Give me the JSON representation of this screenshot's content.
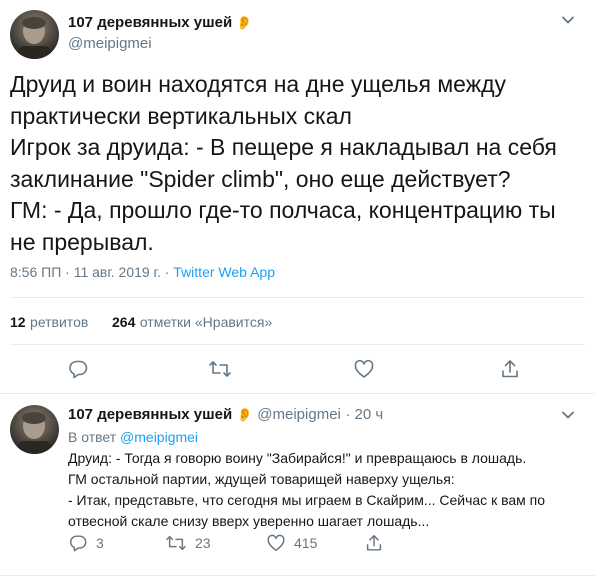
{
  "main_tweet": {
    "display_name": "107 деревянных ушей",
    "handle": "@meipigmei",
    "text": "Друид и воин находятся на дне ущелья между\nпрактически вертикальных скал\nИгрок за друида: - В пещере я накладывал на себя\nзаклинание \"Spider climb\", оно еще действует?\nГМ: - Да, прошло где-то полчаса, концентрацию ты\nне прерывал.",
    "time": "8:56 ПП · 11 авг. 2019 г. ·",
    "source": "Twitter Web App",
    "retweets_count": "12",
    "retweets_label": "ретвитов",
    "likes_count": "264",
    "likes_label": "отметки «Нравится»"
  },
  "reply_tweet": {
    "display_name": "107 деревянных ушей",
    "handle": "@meipigmei",
    "age": "· 20 ч",
    "reply_prefix": "В ответ",
    "reply_to": "@meipigmei",
    "text": "Друид: - Тогда я говорю воину \"Забирайся!\" и превращаюсь в лошадь.\nГМ остальной партии, ждущей товарищей наверху ущелья:\n- Итак, представьте, что сегодня мы играем в Скайрим... Сейчас к вам по\nотвесной скале снизу вверх уверенно шагает лошадь...",
    "reply_count": "3",
    "retweet_count": "23",
    "like_count": "415"
  },
  "icons": {
    "ear": "👂"
  },
  "colors": {
    "accent": "#1da1f2",
    "secondary_text": "#657786",
    "divider": "#e6ecf0"
  }
}
